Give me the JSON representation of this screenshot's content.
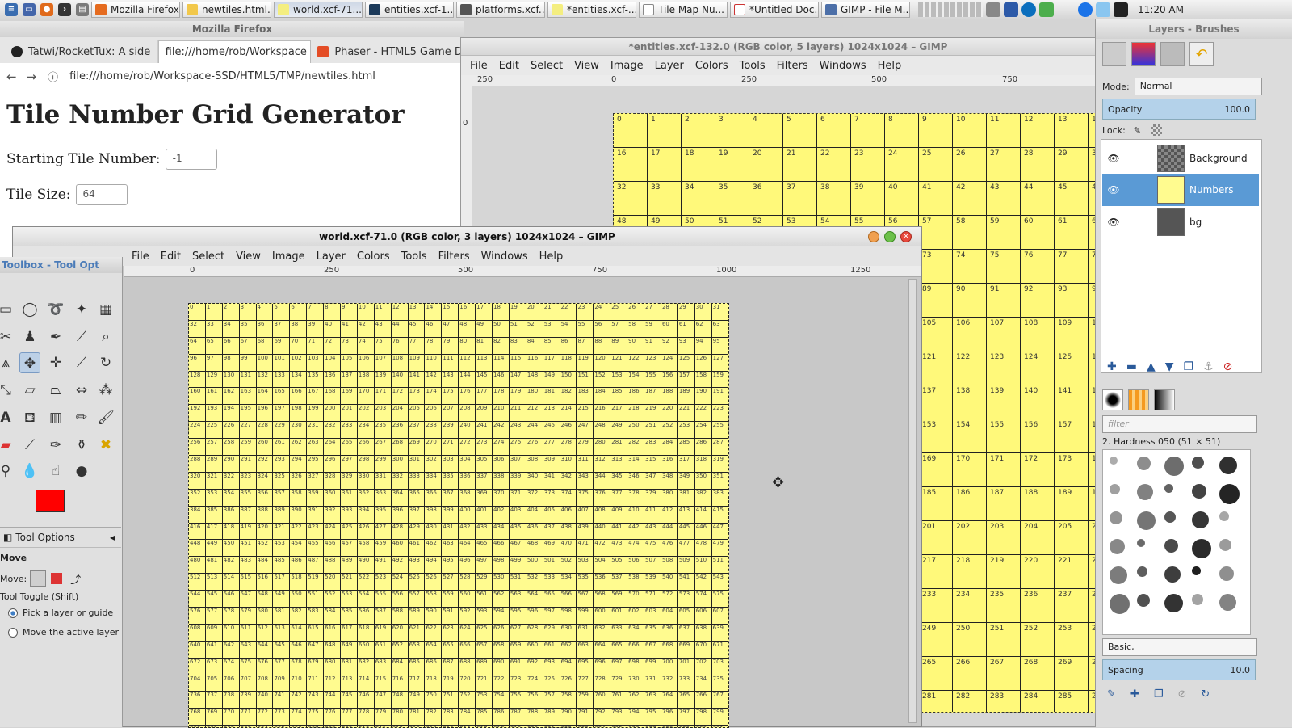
{
  "taskbar": {
    "tasks": [
      "Mozilla Firefox",
      "newtiles.html...",
      "world.xcf-71....",
      "entities.xcf-1...",
      "platforms.xcf...",
      "*entities.xcf-...",
      "Tile Map Nu...",
      "*Untitled Doc...",
      "GIMP - File M..."
    ],
    "clock": "11:20 AM"
  },
  "firefox": {
    "window_title": "Mozilla Firefox",
    "tabs": [
      "Tatwi/RocketTux: A side",
      "file:///home/rob/Workspace",
      "Phaser - HTML5 Game D"
    ],
    "url": "file:///home/rob/Workspace-SSD/HTML5/TMP/newtiles.html",
    "heading": "Tile Number Grid Generator",
    "start_label": "Starting Tile Number:",
    "start_value": "-1",
    "size_label": "Tile Size:",
    "size_value": "64"
  },
  "gimp_entities": {
    "title": "*entities.xcf-132.0 (RGB color, 5 layers) 1024x1024 – GIMP",
    "menu": [
      "File",
      "Edit",
      "Select",
      "View",
      "Image",
      "Layer",
      "Colors",
      "Tools",
      "Filters",
      "Windows",
      "Help"
    ],
    "ruler": [
      "250",
      "0",
      "250",
      "500",
      "750"
    ],
    "vruler0": "0"
  },
  "gimp_world": {
    "title": "world.xcf-71.0 (RGB color, 3 layers) 1024x1024 – GIMP",
    "menu": [
      "File",
      "Edit",
      "Select",
      "View",
      "Image",
      "Layer",
      "Colors",
      "Tools",
      "Filters",
      "Windows",
      "Help"
    ],
    "ruler": [
      "0",
      "250",
      "500",
      "750",
      "1000",
      "1250"
    ]
  },
  "toolbox": {
    "title": "Toolbox - Tool Opt",
    "tool_options_tab": "Tool Options",
    "tool_name": "Move",
    "move_label": "Move:",
    "toggle_label": "Tool Toggle  (Shift)",
    "opt1": "Pick a layer or guide",
    "opt2": "Move the active layer",
    "fg_color": "#ff0000"
  },
  "layers": {
    "title": "Layers - Brushes",
    "mode_label": "Mode:",
    "mode_value": "Normal",
    "opacity_label": "Opacity",
    "opacity_value": "100.0",
    "lock_label": "Lock:",
    "items": [
      "Background",
      "Numbers",
      "bg"
    ],
    "filter_placeholder": "filter",
    "brush_name": "2. Hardness 050 (51 × 51)",
    "preset": "Basic,",
    "spacing_label": "Spacing",
    "spacing_value": "10.0"
  }
}
